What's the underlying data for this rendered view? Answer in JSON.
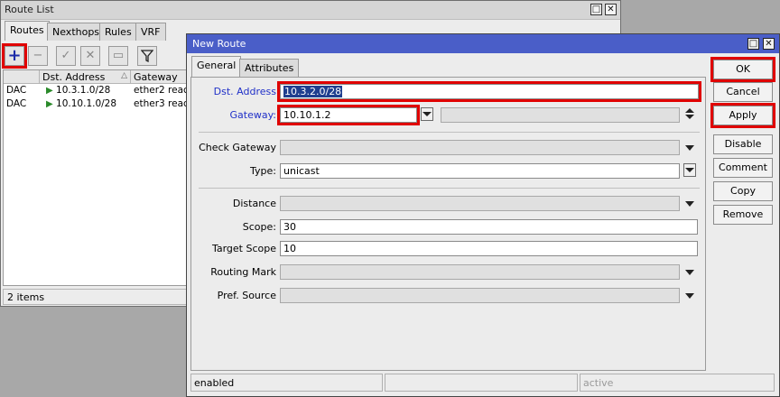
{
  "route_list": {
    "title": "Route List",
    "tabs": [
      "Routes",
      "Nexthops",
      "Rules",
      "VRF"
    ],
    "toolbar": {
      "add": "add-icon",
      "remove": "remove-icon",
      "enable": "check-icon",
      "disable": "cross-icon",
      "comment": "comment-icon",
      "filter": "filter-icon"
    },
    "columns": [
      "",
      "Dst. Address",
      "Gateway"
    ],
    "sort_indicator": "△",
    "rows": [
      {
        "flags": "DAC",
        "dst": "10.3.1.0/28",
        "gateway": "ether2 reac"
      },
      {
        "flags": "DAC",
        "dst": "10.10.1.0/28",
        "gateway": "ether3 reac"
      }
    ],
    "status": "2 items"
  },
  "new_route": {
    "title": "New Route",
    "tabs": [
      "General",
      "Attributes"
    ],
    "fields": {
      "dst_address": {
        "label": "Dst. Address",
        "value": "10.3.2.0/28"
      },
      "gateway": {
        "label": "Gateway:",
        "value": "10.10.1.2"
      },
      "check_gateway": {
        "label": "Check Gateway",
        "value": ""
      },
      "type": {
        "label": "Type:",
        "value": "unicast"
      },
      "distance": {
        "label": "Distance",
        "value": ""
      },
      "scope": {
        "label": "Scope:",
        "value": "30"
      },
      "target_scope": {
        "label": "Target Scope",
        "value": "10"
      },
      "routing_mark": {
        "label": "Routing Mark",
        "value": ""
      },
      "pref_source": {
        "label": "Pref. Source",
        "value": ""
      }
    },
    "buttons": {
      "ok": "OK",
      "cancel": "Cancel",
      "apply": "Apply",
      "disable": "Disable",
      "comment": "Comment",
      "copy": "Copy",
      "remove": "Remove"
    },
    "status": [
      "enabled",
      "",
      "active"
    ]
  },
  "colors": {
    "dialog_title": "#4a5ec8",
    "highlight": "#e00000",
    "blue_label": "#2030c8"
  }
}
